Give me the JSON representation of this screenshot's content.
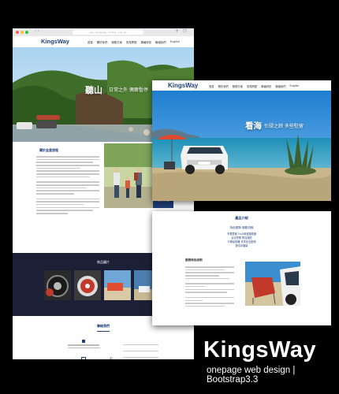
{
  "browser": {
    "url": "www.kingsway-rental.com.tw"
  },
  "brand": {
    "name": "KingsWay",
    "tagline": "onepage web design | Bootstrap3.3"
  },
  "site": {
    "logo": "KingsWay",
    "nav": [
      "首頁",
      "關於我們",
      "服務方案",
      "常見問題",
      "車輛資訊",
      "聯絡我們",
      "English"
    ],
    "nav2": [
      "首頁",
      "關於我們",
      "服務方案",
      "常見問題",
      "車輛資訊",
      "聯絡我們",
      "English"
    ]
  },
  "hero1": {
    "title": "聽山",
    "sub": "日常之外  偶爾暫停"
  },
  "hero2": {
    "title": "看海",
    "sub": "忙碌之餘  多些駐留"
  },
  "about": {
    "title": "關於金皇旅程"
  },
  "cta": {
    "line1": "現在就來",
    "line2": "預約享受"
  },
  "gallery": {
    "title": "商品圖片"
  },
  "contact": {
    "title": "聯絡我們"
  },
  "features": {
    "title": "產品介紹",
    "subtitle": "特色優勢  服務流程",
    "items": [
      "不限里程  24小時道路救援",
      "合法營業  附加保險",
      "行車紀錄器  兒童安全座椅",
      "提供手機架"
    ],
    "list_title": "服務特色說明"
  },
  "colors": {
    "brand": "#1e3f7a",
    "dark_band": "#1b2036",
    "background": "#000000"
  },
  "icons": [
    "phone-icon",
    "mail-icon",
    "line-icon",
    "location-icon"
  ]
}
